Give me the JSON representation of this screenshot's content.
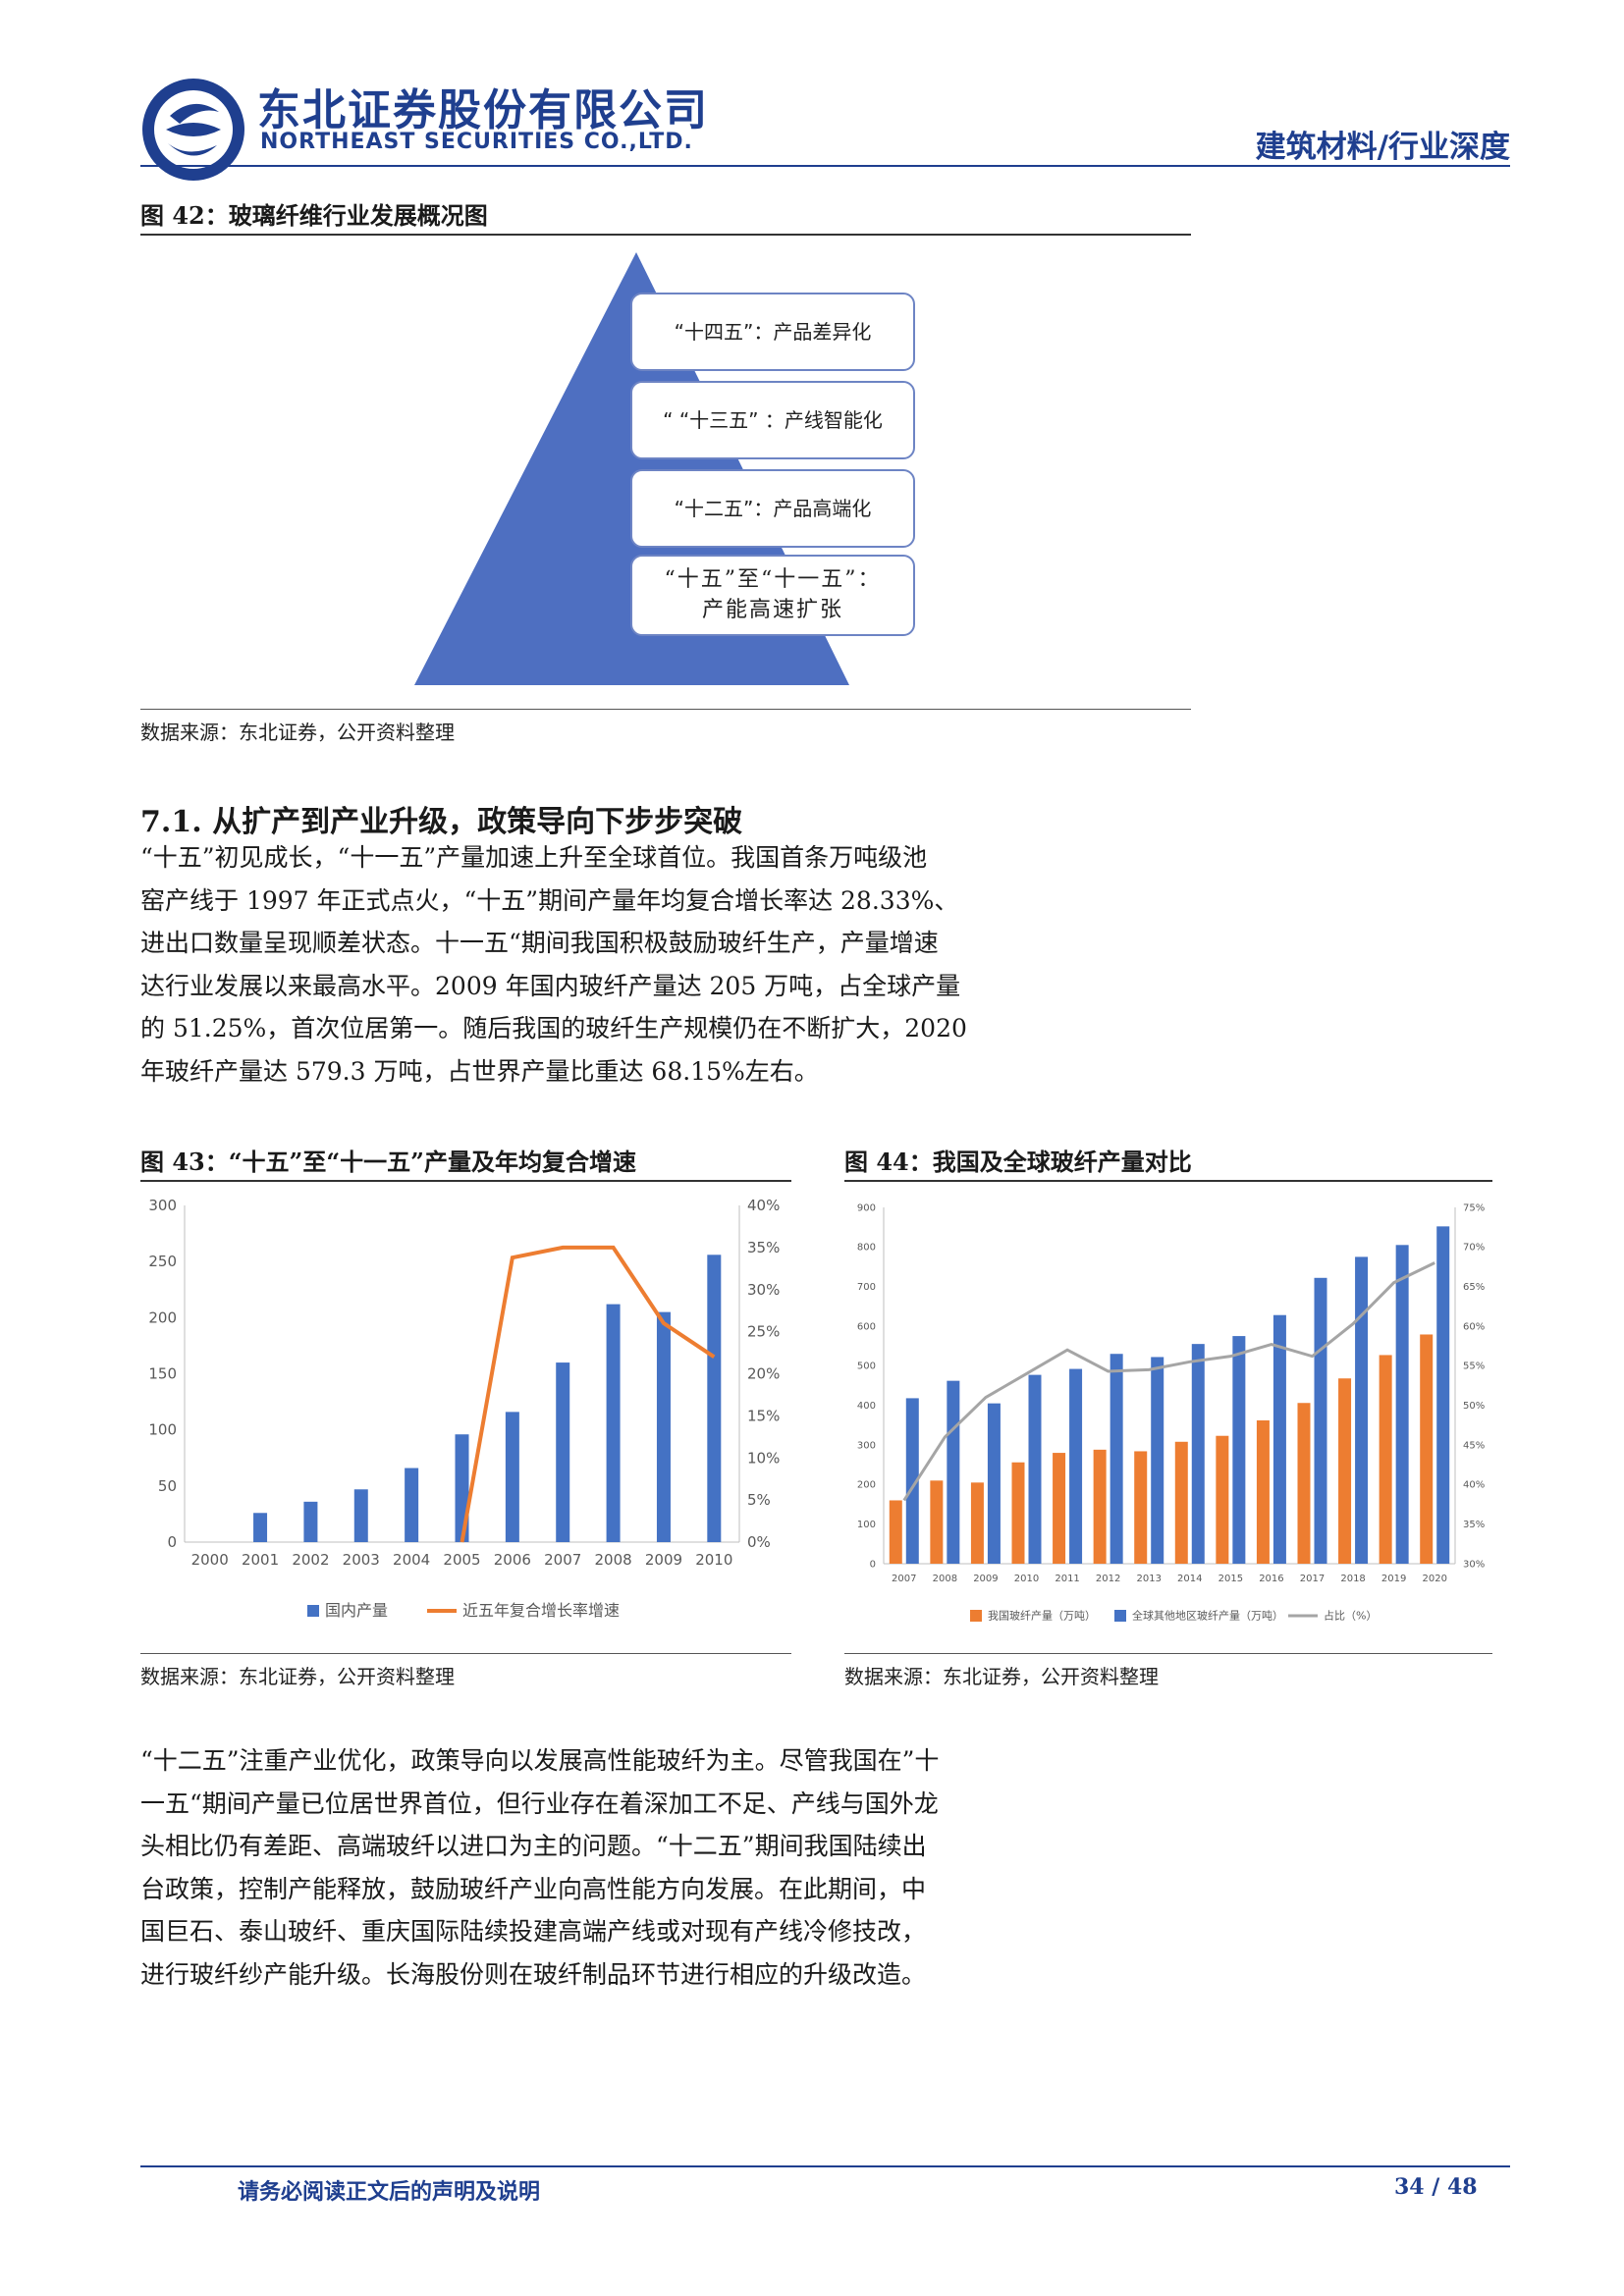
{
  "header": {
    "company_cn": "东北证券股份有限公司",
    "company_en": "NORTHEAST SECURITIES CO.,LTD.",
    "category": "建筑材料/行业深度"
  },
  "figure42": {
    "title": "图 42：玻璃纤维行业发展概况图",
    "labels": [
      "“十四五”：产品差异化",
      "“ “十三五” ：产线智能化",
      "“十二五”：产品高端化",
      "“十五”至“十一五”：",
      "产能高速扩张"
    ],
    "source": "数据来源：东北证券，公开资料整理"
  },
  "section": {
    "title": "7.1. 从扩产到产业升级，政策导向下步步突破",
    "para1": [
      "“十五”初见成长，“十一五”产量加速上升至全球首位。我国首条万吨级池",
      "窑产线于 1997 年正式点火，“十五”期间产量年均复合增长率达 28.33%、",
      "进出口数量呈现顺差状态。十一五“期间我国积极鼓励玻纤生产，产量增速",
      "达行业发展以来最高水平。2009 年国内玻纤产量达 205 万吨，占全球产量",
      "的 51.25%，首次位居第一。随后我国的玻纤生产规模仍在不断扩大，2020",
      "年玻纤产量达 579.3 万吨，占世界产量比重达 68.15%左右。"
    ],
    "para2": [
      "“十二五”注重产业优化，政策导向以发展高性能玻纤为主。尽管我国在”十",
      "一五“期间产量已位居世界首位，但行业存在着深加工不足、产线与国外龙",
      "头相比仍有差距、高端玻纤以进口为主的问题。“十二五”期间我国陆续出",
      "台政策，控制产能释放，鼓励玻纤产业向高性能方向发展。在此期间，中",
      "国巨石、泰山玻纤、重庆国际陆续投建高端产线或对现有产线冷修技改，",
      "进行玻纤纱产能升级。长海股份则在玻纤制品环节进行相应的升级改造。"
    ]
  },
  "figure43": {
    "title": "图 43：“十五”至“十一五”产量及年均复合增速",
    "source": "数据来源：东北证券，公开资料整理",
    "left_ticks": [
      "0",
      "50",
      "100",
      "150",
      "200",
      "250",
      "300"
    ],
    "right_ticks": [
      "0%",
      "5%",
      "10%",
      "15%",
      "20%",
      "25%",
      "30%",
      "35%",
      "40%"
    ]
  },
  "figure44": {
    "title": "图 44：我国及全球玻纤产量对比",
    "source": "数据来源：东北证券，公开资料整理",
    "left_ticks": [
      "0",
      "100",
      "200",
      "300",
      "400",
      "500",
      "600",
      "700",
      "800",
      "900"
    ],
    "right_ticks": [
      "30%",
      "35%",
      "40%",
      "45%",
      "50%",
      "55%",
      "60%",
      "65%",
      "70%",
      "75%"
    ]
  },
  "chart_data": [
    {
      "type": "bar",
      "categories": [
        "2000",
        "2001",
        "2002",
        "2003",
        "2004",
        "2005",
        "2006",
        "2007",
        "2008",
        "2009",
        "2010"
      ],
      "series": [
        {
          "name": "国内产量",
          "type": "bar",
          "axis": "left",
          "color": "#4472c4",
          "values": [
            0,
            26,
            36,
            47,
            66,
            96,
            116,
            160,
            212,
            205,
            256
          ]
        },
        {
          "name": "近五年复合增长率增速",
          "type": "line",
          "axis": "right",
          "color": "#ed7d31",
          "values": [
            null,
            null,
            null,
            null,
            null,
            0.0,
            0.338,
            0.35,
            0.35,
            0.26,
            0.22
          ]
        }
      ],
      "ylim": [
        0,
        300
      ],
      "y2lim": [
        0,
        0.4
      ],
      "grid": false,
      "legend": "bottom"
    },
    {
      "type": "bar",
      "categories": [
        "2007",
        "2008",
        "2009",
        "2010",
        "2011",
        "2012",
        "2013",
        "2014",
        "2015",
        "2016",
        "2017",
        "2018",
        "2019",
        "2020"
      ],
      "series": [
        {
          "name": "我国玻纤产量（万吨）",
          "type": "bar",
          "axis": "left",
          "color": "#ed7d31",
          "values": [
            160,
            210,
            205,
            256,
            280,
            288,
            284,
            308,
            323,
            362,
            406,
            468,
            527,
            579
          ]
        },
        {
          "name": "全球其他地区玻纤产量（万吨）",
          "type": "bar",
          "axis": "left",
          "color": "#4472c4",
          "values": [
            418,
            462,
            405,
            477,
            492,
            530,
            522,
            555,
            575,
            628,
            722,
            775,
            805,
            852
          ]
        },
        {
          "name": "占比（%）",
          "type": "line",
          "axis": "right",
          "color": "#a5a5a5",
          "values": [
            0.38,
            0.46,
            0.51,
            0.54,
            0.57,
            0.543,
            0.545,
            0.555,
            0.562,
            0.577,
            0.562,
            0.603,
            0.655,
            0.68
          ]
        }
      ],
      "ylim": [
        0,
        900
      ],
      "y2lim": [
        0.3,
        0.75
      ],
      "grid": false,
      "legend": "bottom"
    }
  ],
  "footer": {
    "disclaimer": "请务必阅读正文后的声明及说明",
    "page": "34 / 48"
  }
}
